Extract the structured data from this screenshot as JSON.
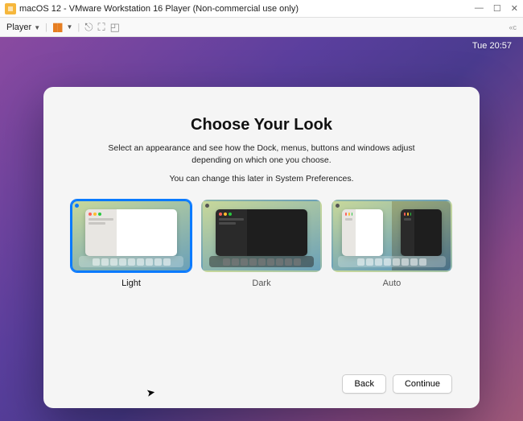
{
  "host": {
    "window_title": "macOS 12 - VMware Workstation 16 Player (Non-commercial use only)",
    "player_menu": "Player",
    "right_label": "«c"
  },
  "menubar": {
    "clock": "Tue 20:57"
  },
  "dialog": {
    "title": "Choose Your Look",
    "subtitle": "Select an appearance and see how the Dock, menus, buttons and windows adjust depending on which one you choose.",
    "note": "You can change this later in System Preferences.",
    "options": {
      "light": "Light",
      "dark": "Dark",
      "auto": "Auto"
    },
    "back": "Back",
    "continue": "Continue"
  }
}
